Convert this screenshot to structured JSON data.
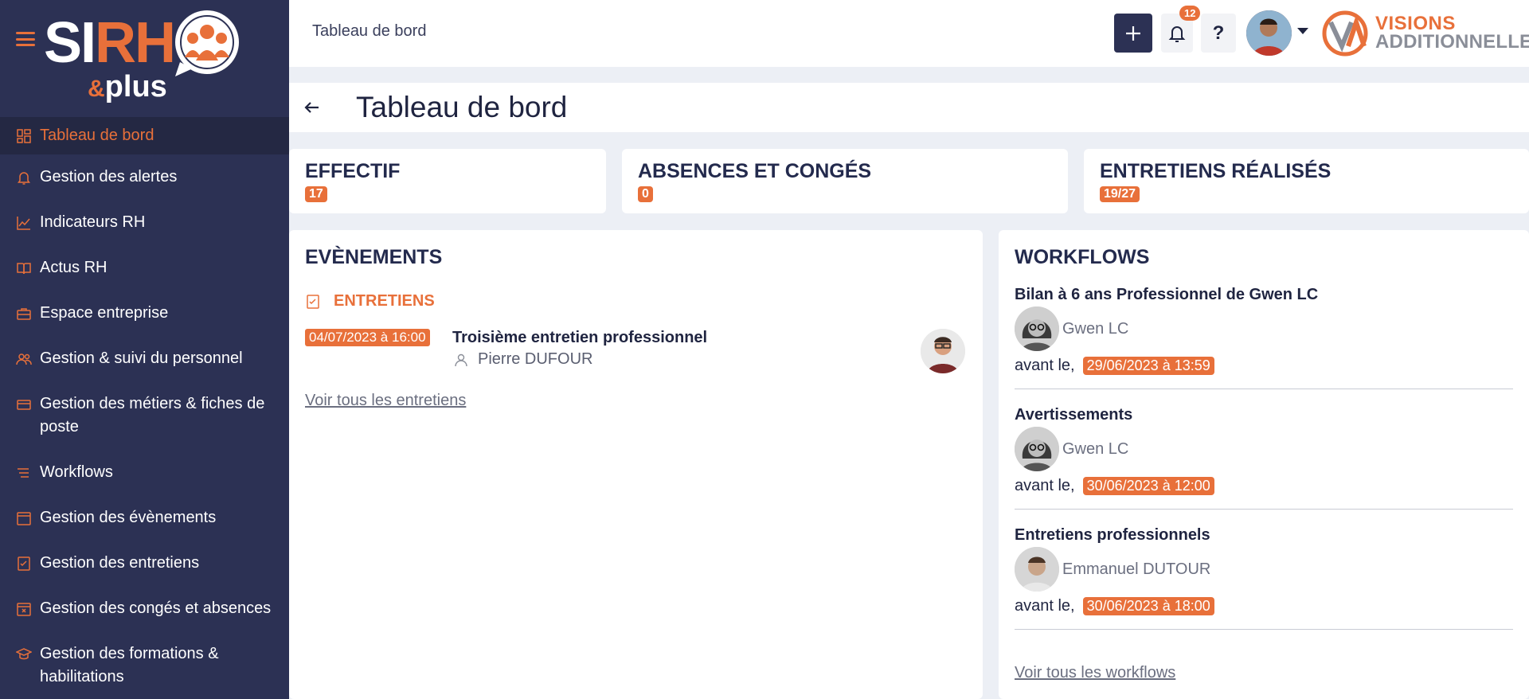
{
  "sidebar": {
    "logo": {
      "si": "SI",
      "rh": "RH",
      "amp": "&",
      "plus": "plus"
    },
    "items": [
      {
        "label": "Tableau de bord",
        "icon": "dashboard-icon",
        "active": true
      },
      {
        "label": "Gestion des alertes",
        "icon": "bell-icon"
      },
      {
        "label": "Indicateurs RH",
        "icon": "chart-icon"
      },
      {
        "label": "Actus RH",
        "icon": "book-icon"
      },
      {
        "label": "Espace entreprise",
        "icon": "briefcase-icon"
      },
      {
        "label": "Gestion & suivi du personnel",
        "icon": "users-icon"
      },
      {
        "label": "Gestion des métiers & fiches de poste",
        "icon": "id-card-icon"
      },
      {
        "label": "Workflows",
        "icon": "list-icon"
      },
      {
        "label": "Gestion des évènements",
        "icon": "calendar-icon"
      },
      {
        "label": "Gestion des entretiens",
        "icon": "checklist-icon"
      },
      {
        "label": "Gestion des congés et absences",
        "icon": "calendar-x-icon"
      },
      {
        "label": "Gestion des formations & habilitations",
        "icon": "graduation-icon"
      }
    ]
  },
  "topbar": {
    "breadcrumb": "Tableau de bord",
    "notification_count": "12",
    "help_label": "?",
    "brand_line1": "VISIONS",
    "brand_line2": "ADDITIONNELLES"
  },
  "page": {
    "title": "Tableau de bord"
  },
  "stats": [
    {
      "label": "EFFECTIF",
      "value": "17"
    },
    {
      "label": "ABSENCES ET CONGÉS",
      "value": "0"
    },
    {
      "label": "ENTRETIENS RÉALISÉS",
      "value": "19/27"
    }
  ],
  "events": {
    "title": "EVÈNEMENTS",
    "section": "ENTRETIENS",
    "items": [
      {
        "date": "04/07/2023 à 16:00",
        "title": "Troisième entretien professionnel",
        "person": "Pierre DUFOUR"
      }
    ],
    "link": "Voir tous les entretiens"
  },
  "workflows": {
    "title": "WORKFLOWS",
    "before_label": "avant le,",
    "items": [
      {
        "name": "Bilan à 6 ans Professionnel de Gwen LC",
        "user": "Gwen LC",
        "due": "29/06/2023 à 13:59"
      },
      {
        "name": "Avertissements",
        "user": "Gwen LC",
        "due": "30/06/2023 à 12:00"
      },
      {
        "name": "Entretiens professionnels",
        "user": "Emmanuel DUTOUR",
        "due": "30/06/2023 à 18:00"
      }
    ],
    "link": "Voir tous les workflows"
  },
  "colors": {
    "accent": "#e8703a",
    "sidebar": "#2c3154",
    "sidebar_active": "#242843",
    "text": "#1f2440"
  }
}
